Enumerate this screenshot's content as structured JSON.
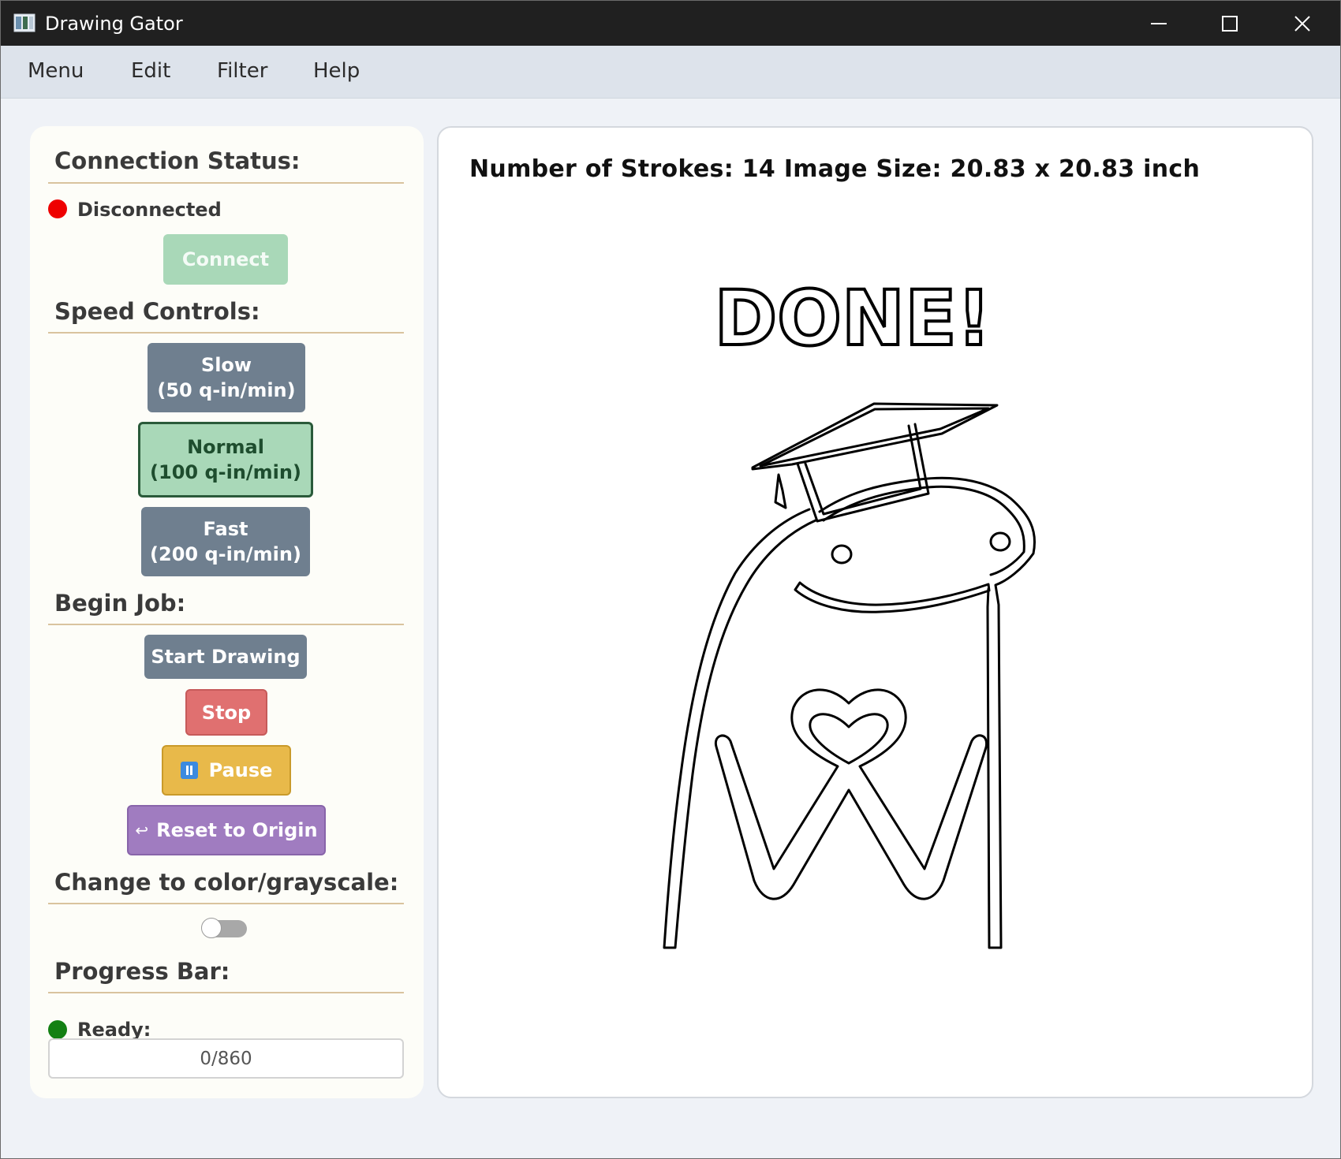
{
  "window": {
    "title": "Drawing Gator"
  },
  "menu": {
    "items": [
      "Menu",
      "Edit",
      "Filter",
      "Help"
    ]
  },
  "connection": {
    "heading": "Connection Status:",
    "status": "Disconnected",
    "status_color": "#ee0000",
    "connect_label": "Connect"
  },
  "speed": {
    "heading": "Speed Controls:",
    "slow": {
      "line1": "Slow",
      "line2": "(50 q-in/min)"
    },
    "normal": {
      "line1": "Normal",
      "line2": "(100 q-in/min)",
      "selected": true
    },
    "fast": {
      "line1": "Fast",
      "line2": "(200 q-in/min)"
    }
  },
  "job": {
    "heading": "Begin Job:",
    "start_label": "Start Drawing",
    "stop_label": "Stop",
    "pause_label": "Pause",
    "reset_label": "Reset to Origin"
  },
  "color_mode": {
    "heading": "Change to color/grayscale:",
    "enabled": false
  },
  "progress": {
    "heading": "Progress Bar:",
    "status": "Ready:",
    "status_color": "#138013",
    "text": "0/860",
    "fraction": 0
  },
  "canvas": {
    "info": "Number of Strokes: 14 Image Size: 20.83 x 20.83 inch",
    "drawing_text": "DONE!"
  },
  "colors": {
    "accent_green": "#a9d8b8",
    "stop_red": "#e07070",
    "pause_yellow": "#e8b94a",
    "reset_purple": "#a07cc0",
    "button_gray": "#6f7f8f"
  }
}
